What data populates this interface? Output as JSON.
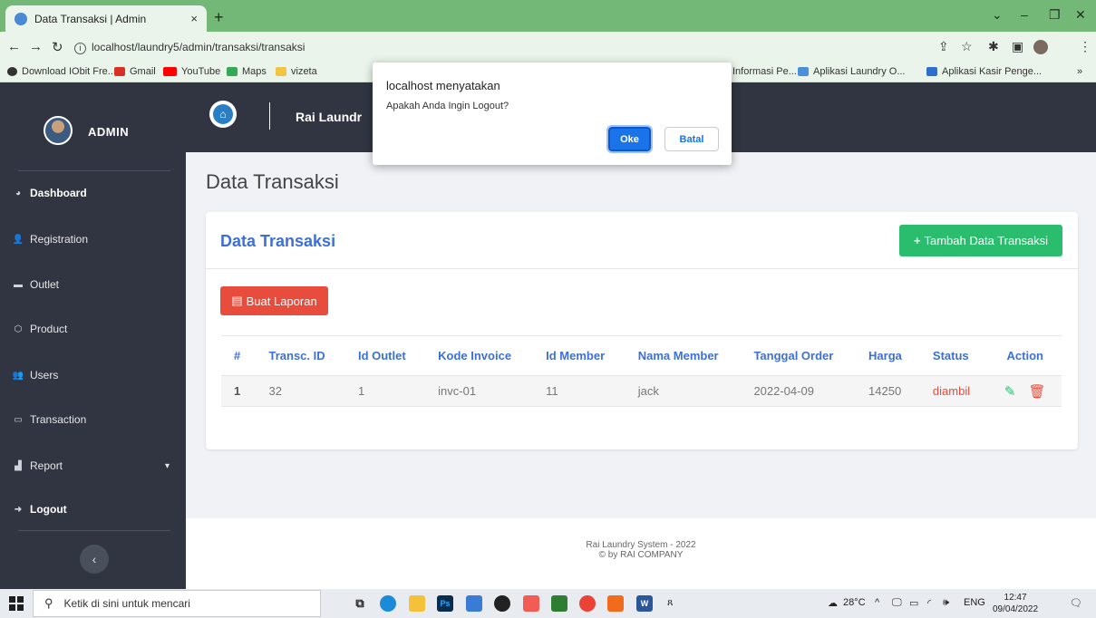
{
  "browser": {
    "tab_title": "Data Transaksi | Admin",
    "tab_close": "×",
    "new_tab": "+",
    "url": "localhost/laundry5/admin/transaksi/transaksi",
    "bookmarks": [
      "Download IObit Fre...",
      "Gmail",
      "YouTube",
      "Maps",
      "vizeta",
      "Informasi Pe...",
      "Aplikasi Laundry O...",
      "Aplikasi Kasir Penge..."
    ],
    "bookmarks_more": "»"
  },
  "sidebar": {
    "brand": "ADMIN",
    "items": [
      {
        "label": "Dashboard",
        "icon": "dashboard-icon"
      },
      {
        "label": "Registration",
        "icon": "user-plus-icon"
      },
      {
        "label": "Outlet",
        "icon": "store-icon"
      },
      {
        "label": "Product",
        "icon": "box-icon"
      },
      {
        "label": "Users",
        "icon": "users-icon"
      },
      {
        "label": "Transaction",
        "icon": "card-icon"
      },
      {
        "label": "Report",
        "icon": "chart-icon"
      },
      {
        "label": "Logout",
        "icon": "logout-icon"
      }
    ]
  },
  "header": {
    "app_title": "Rai Laundr"
  },
  "main": {
    "page_title": "Data Transaksi",
    "card_title": "Data Transaksi",
    "add_button": "Tambah Data Transaksi",
    "report_button": "Buat Laporan",
    "table": {
      "columns": [
        "#",
        "Transc. ID",
        "Id Outlet",
        "Kode Invoice",
        "Id Member",
        "Nama Member",
        "Tanggal Order",
        "Harga",
        "Status",
        "Action"
      ],
      "rows": [
        [
          "1",
          "32",
          "1",
          "invc-01",
          "11",
          "jack",
          "2022-04-09",
          "14250",
          "diambil"
        ]
      ]
    }
  },
  "footer": {
    "line1": "Rai Laundry System - 2022",
    "line2": "© by RAI COMPANY"
  },
  "dialog": {
    "title": "localhost menyatakan",
    "message": "Apakah Anda Ingin Logout?",
    "ok": "Oke",
    "cancel": "Batal"
  },
  "taskbar": {
    "search_placeholder": "Ketik di sini untuk mencari",
    "weather": "28°C",
    "lang": "ENG",
    "time": "12:47",
    "date": "09/04/2022"
  },
  "colors": {
    "sidebar": "#303541",
    "accent_blue": "#3d6fd8",
    "green": "#2bbd6e",
    "red": "#e74c3c",
    "browser_green": "#74b878"
  }
}
